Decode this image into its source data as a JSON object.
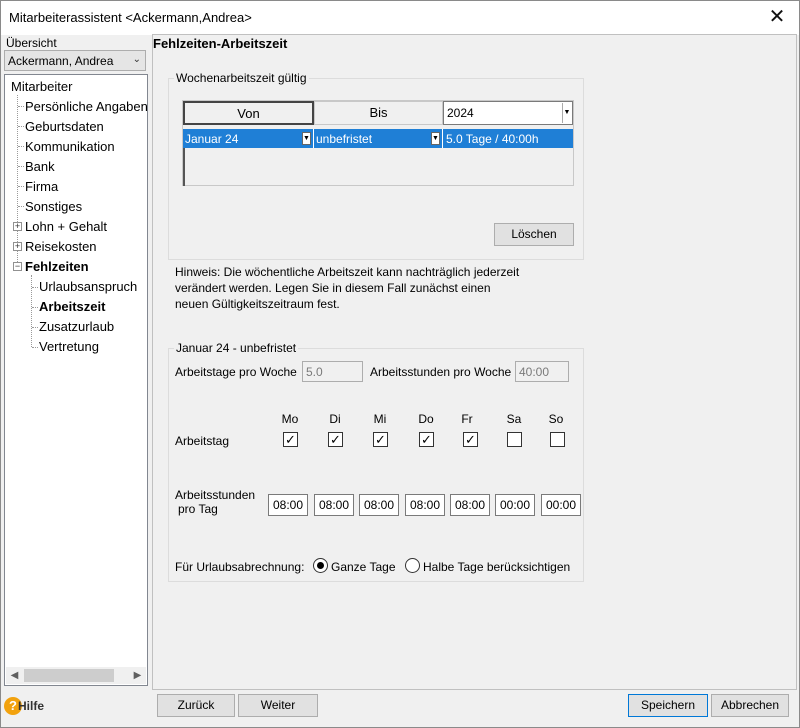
{
  "window": {
    "title": "Mitarbeiterassistent <Ackermann,Andrea>",
    "close_glyph": "✕"
  },
  "left": {
    "overview_label": "Übersicht",
    "employee_combo": "Ackermann, Andrea",
    "tree": {
      "root": "Mitarbeiter",
      "items": [
        "Persönliche Angaben",
        "Geburtsdaten",
        "Kommunikation",
        "Bank",
        "Firma",
        "Sonstiges",
        "Lohn + Gehalt",
        "Reisekosten",
        "Fehlzeiten"
      ],
      "subitems": [
        "Urlaubsanspruch",
        "Arbeitszeit",
        "Zusatzurlaub",
        "Vertretung"
      ]
    }
  },
  "main": {
    "section_title": "Fehlzeiten-Arbeitszeit",
    "wochen": {
      "group_label": "Wochenarbeitszeit gültig",
      "col_von": "Von",
      "col_bis": "Bis",
      "year": "2024",
      "row": {
        "von": "Januar 24",
        "bis": "unbefristet",
        "summary": "5.0 Tage / 40:00h"
      },
      "delete_button": "Löschen"
    },
    "hint": "Hinweis: Die wöchentliche Arbeitszeit kann nachträglich jederzeit verändert werden. Legen Sie in diesem Fall zunächst einen neuen Gültigkeitszeitraum fest.",
    "detail": {
      "group_label": "Januar 24 - unbefristet",
      "days_per_week_label": "Arbeitstage pro Woche",
      "days_per_week_value": "5.0",
      "hours_per_week_label": "Arbeitsstunden pro Woche",
      "hours_per_week_value": "40:00",
      "workday_label": "Arbeitstag",
      "hours_per_day_label_1": "Arbeitsstunden",
      "hours_per_day_label_2": "pro Tag",
      "days": [
        "Mo",
        "Di",
        "Mi",
        "Do",
        "Fr",
        "Sa",
        "So"
      ],
      "checked": [
        true,
        true,
        true,
        true,
        true,
        false,
        false
      ],
      "hours": [
        "08:00",
        "08:00",
        "08:00",
        "08:00",
        "08:00",
        "00:00",
        "00:00"
      ],
      "vacation_label": "Für Urlaubsabrechnung:",
      "radio_full": "Ganze Tage",
      "radio_half": "Halbe Tage berücksichtigen",
      "selected_radio": "Ganze Tage"
    }
  },
  "footer": {
    "help": "Hilfe",
    "back": "Zurück",
    "next": "Weiter",
    "save": "Speichern",
    "cancel": "Abbrechen"
  }
}
